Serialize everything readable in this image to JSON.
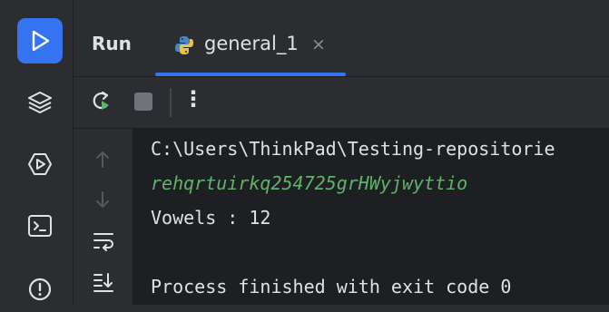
{
  "window": {
    "title": "Run"
  },
  "tabs": [
    {
      "label": "general_1",
      "icon": "python-icon",
      "close_glyph": "×"
    }
  ],
  "left_bar": {
    "items": [
      {
        "name": "run-icon",
        "active": true
      },
      {
        "name": "layers-icon",
        "active": false
      },
      {
        "name": "services-icon",
        "active": false
      },
      {
        "name": "terminal-icon",
        "active": false
      },
      {
        "name": "problems-icon",
        "active": false
      }
    ]
  },
  "toolbar": {
    "rerun_icon": "rerun-icon",
    "stop_icon": "stop-icon",
    "more_glyph": "⋮"
  },
  "gutter": {
    "icons": [
      "arrow-up-icon",
      "arrow-down-icon",
      "soft-wrap-icon",
      "scroll-to-end-icon"
    ]
  },
  "console": {
    "path_line": "C:\\Users\\ThinkPad\\Testing-repositorie",
    "input_line": "rehqrtuirkq254725grHWyjwyttio",
    "output_line": "Vowels : 12",
    "exit_line": "Process finished with exit code 0"
  },
  "colors": {
    "accent": "#3574f0",
    "background": "#2b2d30",
    "console_background": "#1e1f22",
    "text": "#dfe1e5",
    "input_text": "#5fb46a",
    "icon_muted": "#8c8f94"
  }
}
